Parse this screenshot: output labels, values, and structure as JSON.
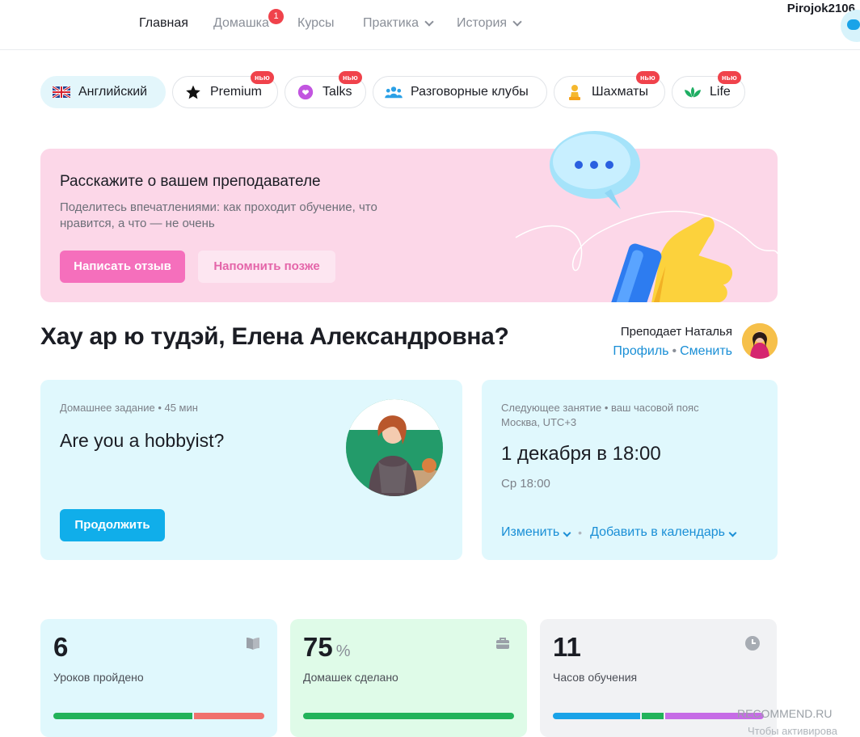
{
  "nav": {
    "items": [
      {
        "label": "Главная"
      },
      {
        "label": "Домашка",
        "badge": "1"
      },
      {
        "label": "Курсы"
      },
      {
        "label": "Практика"
      },
      {
        "label": "История"
      }
    ],
    "username": "Pirojok2106"
  },
  "chips": [
    {
      "label": "Английский",
      "icon": "uk-flag-icon"
    },
    {
      "label": "Premium",
      "icon": "star-icon",
      "badge": "нью"
    },
    {
      "label": "Talks",
      "icon": "chat-heart-icon",
      "badge": "нью"
    },
    {
      "label": "Разговорные клубы",
      "icon": "people-icon"
    },
    {
      "label": "Шахматы",
      "icon": "chess-pawn-icon",
      "badge": "нью"
    },
    {
      "label": "Life",
      "icon": "lotus-icon",
      "badge": "нью"
    }
  ],
  "promo": {
    "title": "Расскажите о вашем преподавателе",
    "text": "Поделитесь впечатлениями: как проходит обучение, что нравится, а что — не очень",
    "primary_button": "Написать отзыв",
    "secondary_button": "Напомнить позже"
  },
  "greeting": "Хау ар ю тудэй, Елена Александровна?",
  "teacher": {
    "label": "Преподает Наталья",
    "profile_link": "Профиль",
    "separator": "•",
    "change_link": "Сменить"
  },
  "homework": {
    "meta": "Домашнее задание • 45 мин",
    "title": "Are you a hobbyist?",
    "button": "Продолжить"
  },
  "lesson": {
    "meta_line1": "Следующее занятие • ваш часовой пояс",
    "meta_line2": "Москва, UTC+3",
    "date": "1 декабря в 18:00",
    "time": "Ср 18:00",
    "change": "Изменить",
    "separator": "•",
    "add_calendar": "Добавить в календарь"
  },
  "stats": [
    {
      "value": "6",
      "unit": "",
      "label": "Уроков пройдено",
      "icon": "book-icon",
      "bg": "#e0f8fd",
      "bar": [
        {
          "color": "#22b35a",
          "fraction": 0.66
        },
        {
          "color": "#f0716d",
          "fraction": 0.34
        }
      ]
    },
    {
      "value": "75",
      "unit": "%",
      "label": "Домашек сделано",
      "icon": "briefcase-icon",
      "bg": "#dffbe8",
      "bar": [
        {
          "color": "#22b35a",
          "fraction": 1.0
        }
      ]
    },
    {
      "value": "11",
      "unit": "",
      "label": "Часов обучения",
      "icon": "clock-icon",
      "bg": "#f1f2f4",
      "bar": [
        {
          "color": "#1aa3e8",
          "fraction": 0.47
        },
        {
          "color": "#22b35a",
          "fraction": 0.11
        },
        {
          "color": "#c66ce6",
          "fraction": 0.42
        }
      ]
    }
  ],
  "watermark": {
    "line1": "RECOMMEND.RU",
    "line2": "Чтобы активирова"
  }
}
